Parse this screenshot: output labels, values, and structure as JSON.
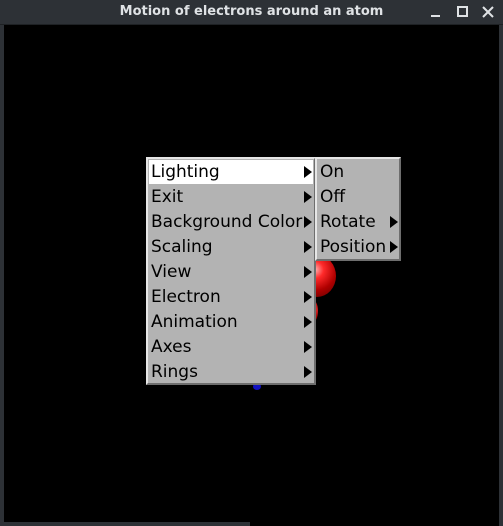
{
  "window": {
    "title": "Motion of electrons around an atom",
    "controls": [
      "minimize-icon",
      "maximize-icon",
      "close-icon"
    ]
  },
  "colors": {
    "titlebar_bg": "#2d3136",
    "title_text": "#dfe2e5",
    "canvas_bg": "#000000",
    "menu_bg": "#b3b3b3",
    "menu_highlight": "#ffffff",
    "electron_red": "#ff2a2a",
    "electron_blue": "#1010c0"
  },
  "main_menu": {
    "items": [
      {
        "label": "Lighting",
        "has_submenu": true,
        "highlighted": true
      },
      {
        "label": "Exit",
        "has_submenu": true
      },
      {
        "label": "Background Color",
        "has_submenu": true
      },
      {
        "label": "Scaling",
        "has_submenu": true
      },
      {
        "label": "View",
        "has_submenu": true
      },
      {
        "label": "Electron",
        "has_submenu": true
      },
      {
        "label": "Animation",
        "has_submenu": true
      },
      {
        "label": "Axes",
        "has_submenu": true
      },
      {
        "label": "Rings",
        "has_submenu": true
      }
    ]
  },
  "lighting_submenu": {
    "items": [
      {
        "label": "On",
        "has_submenu": false
      },
      {
        "label": "Off",
        "has_submenu": false
      },
      {
        "label": "Rotate",
        "has_submenu": true
      },
      {
        "label": "Position",
        "has_submenu": true
      }
    ]
  }
}
